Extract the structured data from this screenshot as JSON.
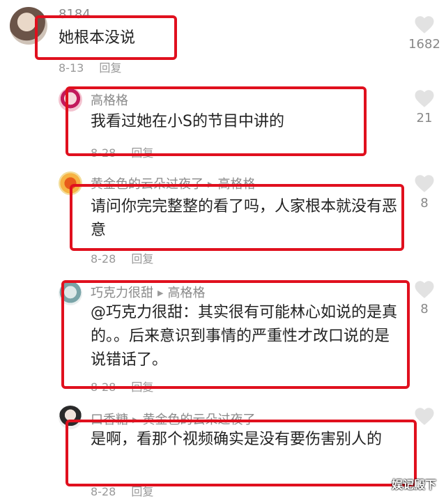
{
  "comments": [
    {
      "author": "8184",
      "text": "她根本没说",
      "date": "8-13",
      "reply_label": "回复",
      "likes": "1682"
    },
    {
      "author": "高格格",
      "text": "我看过她在小S的节目中讲的",
      "date": "8-28",
      "reply_label": "回复",
      "likes": "21"
    },
    {
      "author": "黄金色的云朵过夜了",
      "reply_to": "高格格",
      "text": "请问你完完整整的看了吗，人家根本就没有恶意",
      "date": "8-28",
      "reply_label": "回复",
      "likes": "8"
    },
    {
      "author": "巧克力很甜",
      "reply_to": "高格格",
      "text": "@巧克力很甜：其实很有可能林心如说的是真的。。后来意识到事情的严重性才改口说的是说错话了。",
      "date": "8-28",
      "reply_label": "回复",
      "likes": "8"
    },
    {
      "author": "口香糖",
      "reply_to": "黄金色的云朵过夜了",
      "text": "是啊，看那个视频确实是没有要伤害别人的",
      "date": "8-28",
      "reply_label": "回复",
      "likes": ""
    }
  ],
  "watermark": "娱记殿下",
  "colors": {
    "highlight": "#e0101e",
    "muted": "#999999"
  },
  "icons": {
    "like": "heart-icon",
    "reply_arrow": "triangle-right-icon"
  }
}
